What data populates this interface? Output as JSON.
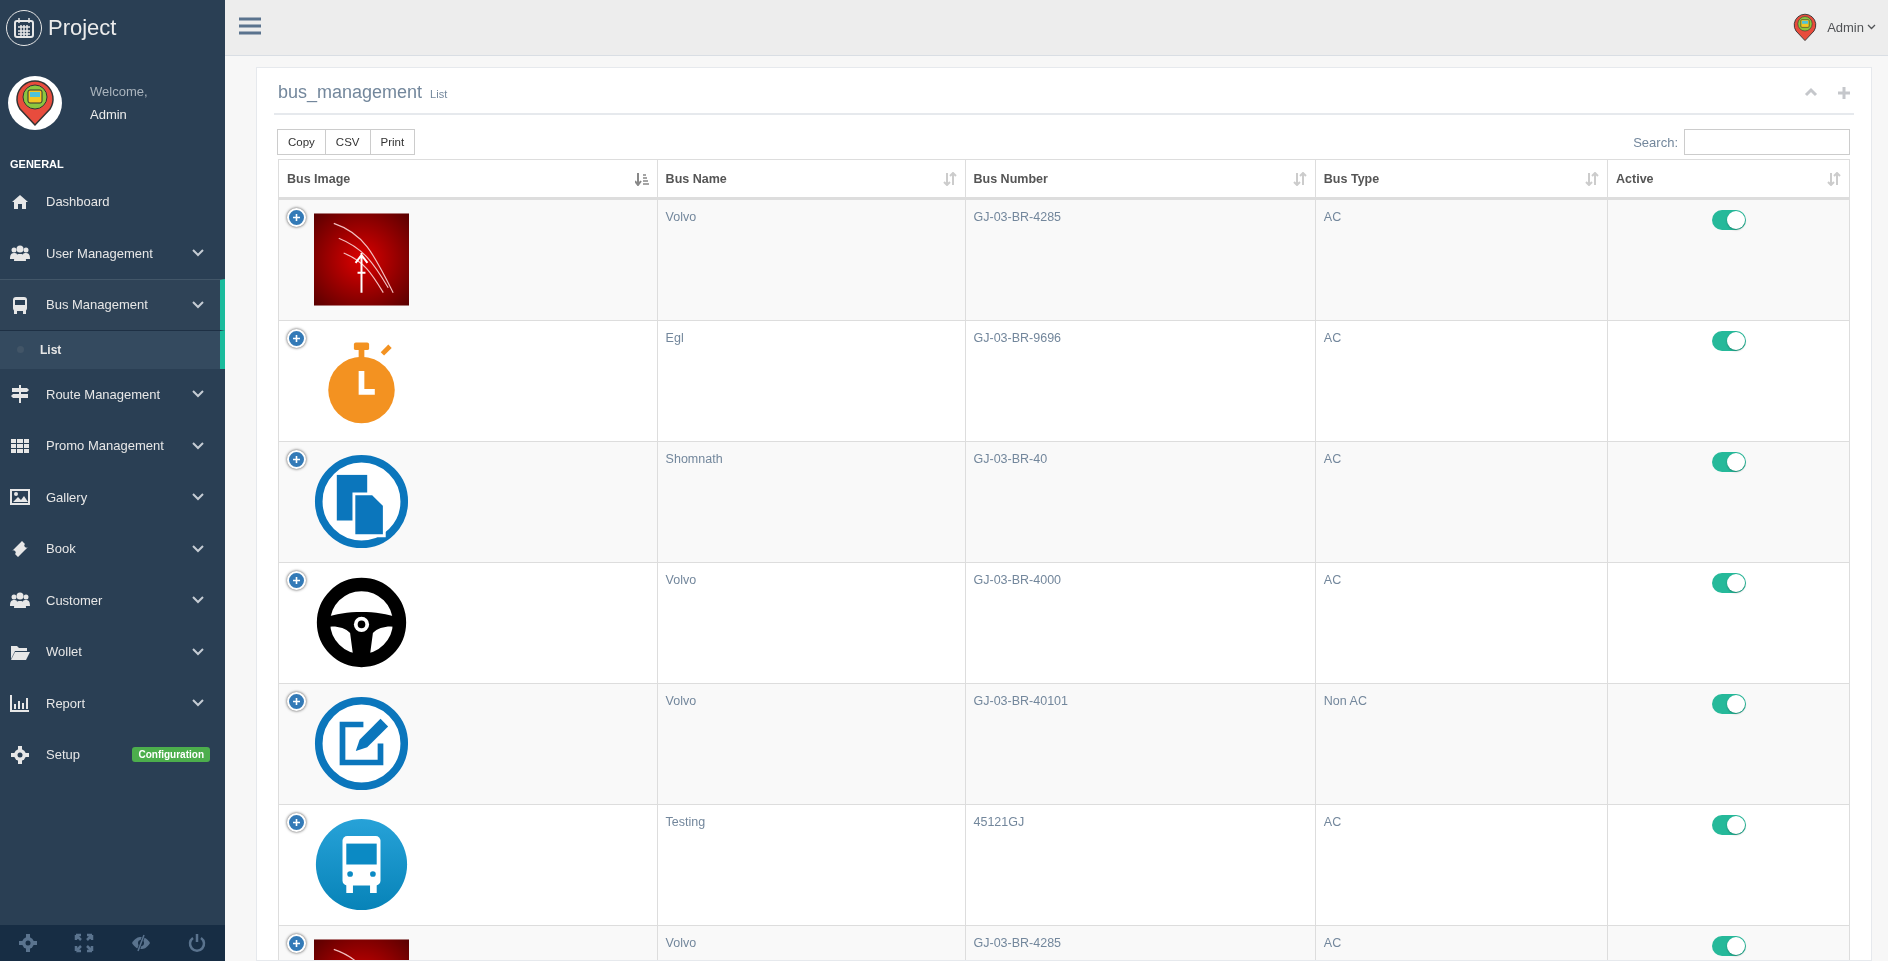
{
  "brand": {
    "title": "Project"
  },
  "profile": {
    "greeting": "Welcome,",
    "name": "Admin"
  },
  "sidebar": {
    "section": "GENERAL",
    "items": [
      {
        "label": "Dashboard",
        "expandable": false,
        "selected": false
      },
      {
        "label": "User Management",
        "expandable": true,
        "selected": false
      },
      {
        "label": "Bus Management",
        "expandable": true,
        "selected": true,
        "expanded": true,
        "children": [
          {
            "label": "List",
            "selected": true
          }
        ]
      },
      {
        "label": "Route Management",
        "expandable": true,
        "selected": false
      },
      {
        "label": "Promo Management",
        "expandable": true,
        "selected": false
      },
      {
        "label": "Gallery",
        "expandable": true,
        "selected": false
      },
      {
        "label": "Book",
        "expandable": true,
        "selected": false
      },
      {
        "label": "Customer",
        "expandable": true,
        "selected": false
      },
      {
        "label": "Wollet",
        "expandable": true,
        "selected": false
      },
      {
        "label": "Report",
        "expandable": true,
        "selected": false
      },
      {
        "label": "Setup",
        "expandable": false,
        "selected": false,
        "badge": "Configuration"
      }
    ]
  },
  "topbar": {
    "user": "Admin"
  },
  "panel": {
    "title": "bus_management",
    "subtitle": "List",
    "buttons": [
      "Copy",
      "CSV",
      "Print"
    ],
    "search_label": "Search:",
    "table": {
      "columns": [
        {
          "label": "Bus Image",
          "sorted": true
        },
        {
          "label": "Bus Name",
          "sorted": false
        },
        {
          "label": "Bus Number",
          "sorted": false
        },
        {
          "label": "Bus Type",
          "sorted": false
        },
        {
          "label": "Active",
          "sorted": false
        }
      ],
      "rows": [
        {
          "name": "Volvo",
          "number": "GJ-03-BR-4285",
          "type": "AC",
          "active": true
        },
        {
          "name": "Egl",
          "number": "GJ-03-BR-9696",
          "type": "AC",
          "active": true
        },
        {
          "name": "Shomnath",
          "number": "GJ-03-BR-40",
          "type": "AC",
          "active": true
        },
        {
          "name": "Volvo",
          "number": "GJ-03-BR-4000",
          "type": "AC",
          "active": true
        },
        {
          "name": "Volvo",
          "number": "GJ-03-BR-40101",
          "type": "Non AC",
          "active": true
        },
        {
          "name": "Testing",
          "number": "45121GJ",
          "type": "AC",
          "active": true
        },
        {
          "name": "Volvo",
          "number": "GJ-03-BR-4285",
          "type": "AC",
          "active": true
        }
      ]
    }
  }
}
